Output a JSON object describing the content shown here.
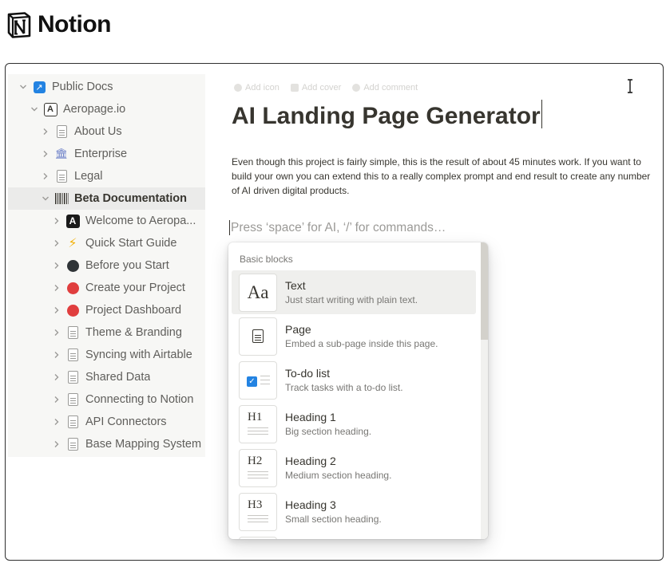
{
  "brand": {
    "name": "Notion"
  },
  "sidebar": {
    "items": [
      {
        "label": "Public Docs",
        "icon": "external-link-icon",
        "level": 0,
        "expanded": true
      },
      {
        "label": "Aeropage.io",
        "icon": "aeropage-icon",
        "level": 1,
        "expanded": true
      },
      {
        "label": "About Us",
        "icon": "page-icon",
        "level": 2,
        "expanded": false
      },
      {
        "label": "Enterprise",
        "icon": "bank-icon",
        "level": 2,
        "expanded": false
      },
      {
        "label": "Legal",
        "icon": "page-icon",
        "level": 2,
        "expanded": false
      },
      {
        "label": "Beta Documentation",
        "icon": "barcode-icon",
        "level": 2,
        "expanded": true,
        "active": true
      },
      {
        "label": "Welcome to Aeropa...",
        "icon": "aeropage-icon",
        "level": 3,
        "expanded": false
      },
      {
        "label": "Quick Start Guide",
        "icon": "lightning-icon",
        "level": 3,
        "expanded": false
      },
      {
        "label": "Before you Start",
        "icon": "black-circle-icon",
        "level": 3,
        "expanded": false
      },
      {
        "label": "Create your Project",
        "icon": "red-circle-icon",
        "level": 3,
        "expanded": false
      },
      {
        "label": "Project Dashboard",
        "icon": "red-circle-icon",
        "level": 3,
        "expanded": false
      },
      {
        "label": "Theme & Branding",
        "icon": "page-icon",
        "level": 3,
        "expanded": false
      },
      {
        "label": "Syncing with Airtable",
        "icon": "page-icon",
        "level": 3,
        "expanded": false
      },
      {
        "label": "Shared Data",
        "icon": "page-icon",
        "level": 3,
        "expanded": false
      },
      {
        "label": "Connecting to Notion",
        "icon": "page-icon",
        "level": 3,
        "expanded": false
      },
      {
        "label": "API Connectors",
        "icon": "page-icon",
        "level": 3,
        "expanded": false
      },
      {
        "label": "Base Mapping System",
        "icon": "page-icon",
        "level": 3,
        "expanded": false
      }
    ]
  },
  "page": {
    "actions": {
      "add_icon": "Add icon",
      "add_cover": "Add cover",
      "add_comment": "Add comment"
    },
    "title": "AI Landing Page Generator",
    "body": "Even though this project is fairly simple, this is the result of about 45 minutes work. If you want to build your own you can extend this to a really complex prompt and end result to create any number of AI driven digital products.",
    "command_placeholder": "Press ‘space’ for AI, ‘/’ for commands…"
  },
  "block_menu": {
    "heading": "Basic blocks",
    "items": [
      {
        "title": "Text",
        "desc": "Just start writing with plain text.",
        "icon": "text-aa-icon",
        "highlighted": true
      },
      {
        "title": "Page",
        "desc": "Embed a sub-page inside this page.",
        "icon": "page-icon"
      },
      {
        "title": "To-do list",
        "desc": "Track tasks with a to-do list.",
        "icon": "todo-checkbox-icon"
      },
      {
        "title": "Heading 1",
        "desc": "Big section heading.",
        "icon": "heading-1-icon",
        "thumb": "H1"
      },
      {
        "title": "Heading 2",
        "desc": "Medium section heading.",
        "icon": "heading-2-icon",
        "thumb": "H2"
      },
      {
        "title": "Heading 3",
        "desc": "Small section heading.",
        "icon": "heading-3-icon",
        "thumb": "H3"
      }
    ],
    "thumb_text": "Aa"
  },
  "colors": {
    "accent": "#2383e2",
    "text": "#37352f",
    "muted": "#787774",
    "red_dot": "#e03e3e",
    "sidebar_bg": "#f7f7f5"
  }
}
